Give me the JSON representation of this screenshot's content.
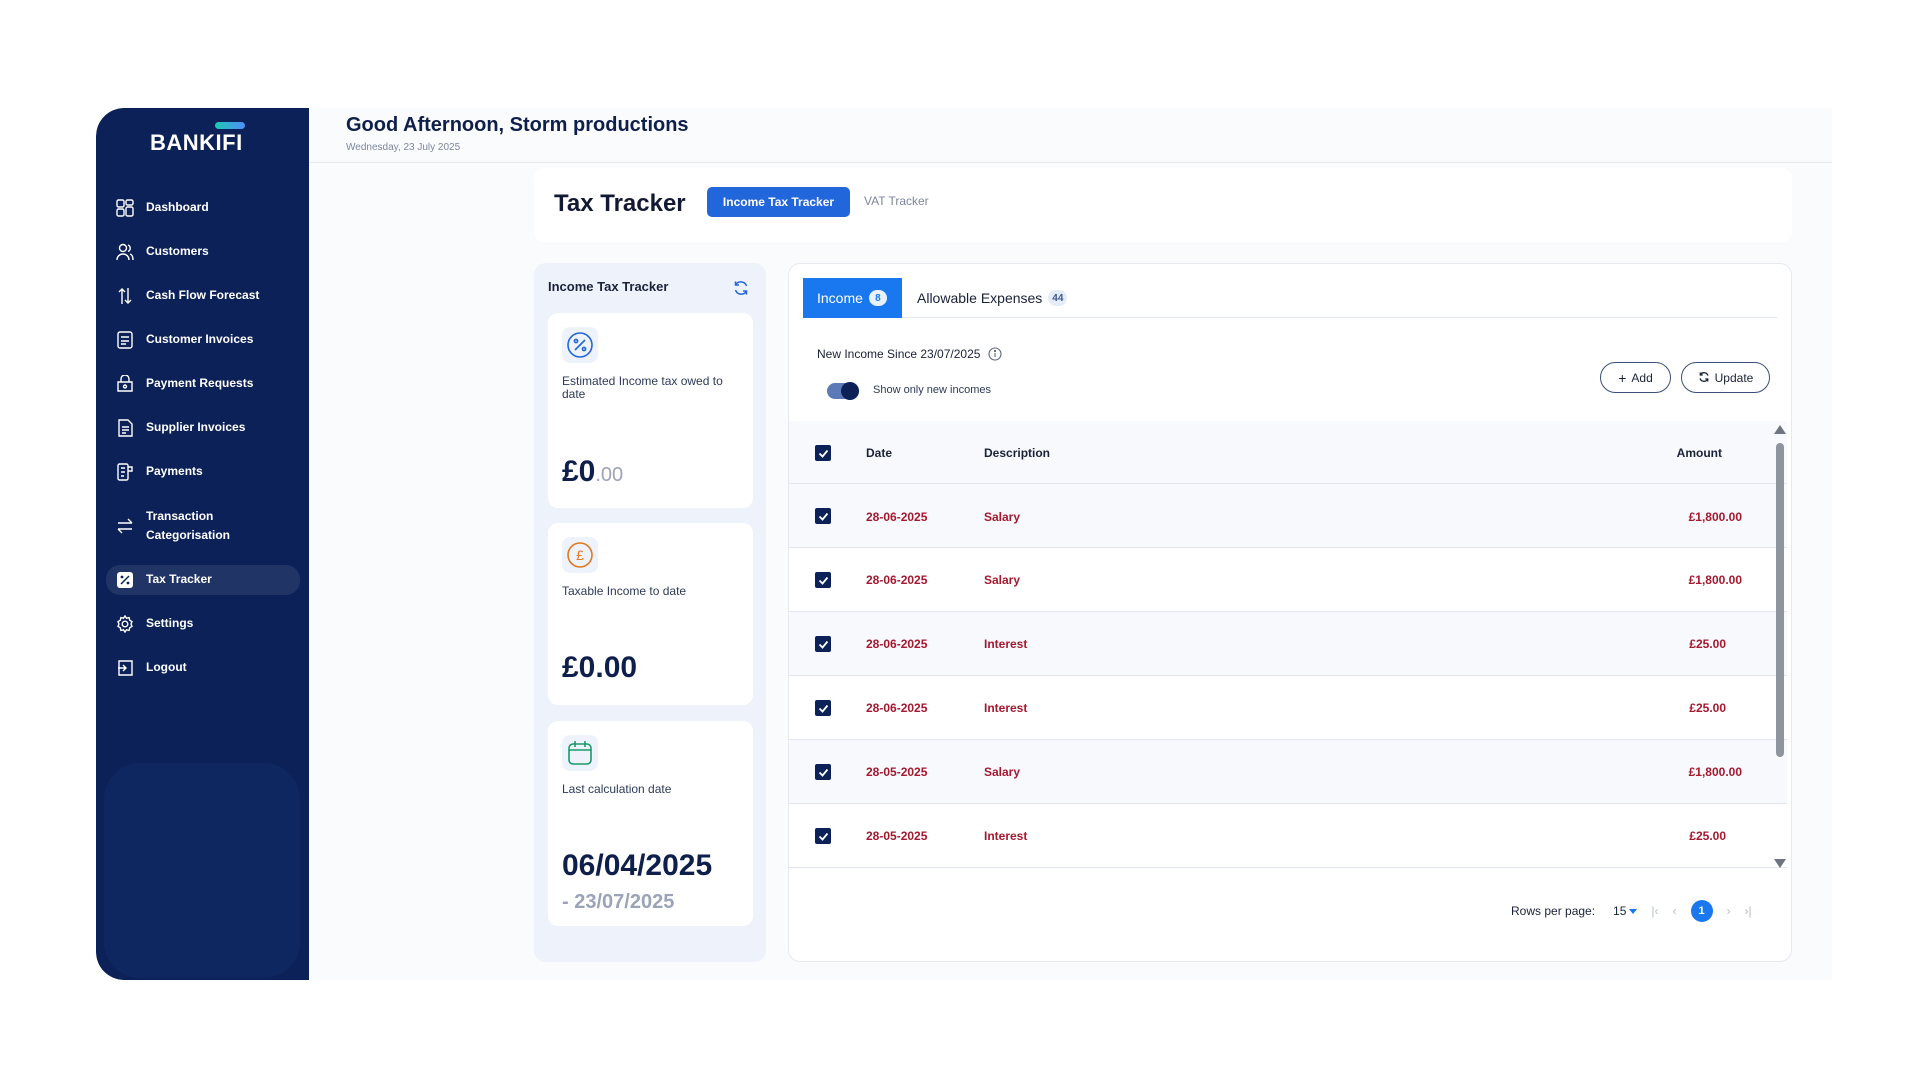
{
  "brand": {
    "name": "BANKIFI"
  },
  "header": {
    "greeting": "Good Afternoon, Storm productions",
    "date": "Wednesday, 23 July 2025"
  },
  "sidebar": {
    "items": [
      {
        "label": "Dashboard",
        "icon": "dashboard-icon"
      },
      {
        "label": "Customers",
        "icon": "customers-icon"
      },
      {
        "label": "Cash Flow Forecast",
        "icon": "cash-flow-icon"
      },
      {
        "label": "Customer Invoices",
        "icon": "invoice-icon"
      },
      {
        "label": "Payment Requests",
        "icon": "payment-request-icon"
      },
      {
        "label": "Supplier Invoices",
        "icon": "supplier-invoice-icon"
      },
      {
        "label": "Payments",
        "icon": "payments-icon"
      },
      {
        "label": "Transaction Categorisation",
        "icon": "transfer-icon"
      },
      {
        "label": "Tax Tracker",
        "icon": "tax-icon",
        "active": true
      },
      {
        "label": "Settings",
        "icon": "gear-icon"
      },
      {
        "label": "Logout",
        "icon": "logout-icon"
      }
    ]
  },
  "tracker": {
    "title": "Tax Tracker",
    "tabs": [
      "Income Tax Tracker",
      "VAT Tracker"
    ]
  },
  "stats": {
    "title": "Income Tax Tracker",
    "owed": {
      "label": "Estimated Income tax owed to date",
      "whole": "£0",
      "decimal": ".00"
    },
    "taxable": {
      "label": "Taxable Income to date",
      "value": "£0.00"
    },
    "last_calc": {
      "label": "Last calculation date",
      "from": "06/04/2025",
      "to": "- 23/07/2025"
    }
  },
  "main": {
    "tabs": [
      {
        "label": "Income",
        "count": "8"
      },
      {
        "label": "Allowable Expenses",
        "count": "44"
      }
    ],
    "new_income_label": "New Income Since 23/07/2025",
    "toggle_label": "Show only new incomes",
    "add_label": "Add",
    "update_label": "Update",
    "columns": {
      "date": "Date",
      "description": "Description",
      "amount": "Amount"
    },
    "rows": [
      {
        "date": "28-06-2025",
        "description": "Salary",
        "amount": "£1,800.00"
      },
      {
        "date": "28-06-2025",
        "description": "Salary",
        "amount": "£1,800.00"
      },
      {
        "date": "28-06-2025",
        "description": "Interest",
        "amount": "£25.00"
      },
      {
        "date": "28-06-2025",
        "description": "Interest",
        "amount": "£25.00"
      },
      {
        "date": "28-05-2025",
        "description": "Salary",
        "amount": "£1,800.00"
      },
      {
        "date": "28-05-2025",
        "description": "Interest",
        "amount": "£25.00"
      }
    ],
    "pagination": {
      "rows_per_page_label": "Rows per page:",
      "rows_per_page": "15",
      "current_page": "1"
    }
  },
  "colors": {
    "sidebar": "#0b2157",
    "accent": "#1978ef",
    "primary_button": "#2266db",
    "amount_text": "#a3192e"
  }
}
